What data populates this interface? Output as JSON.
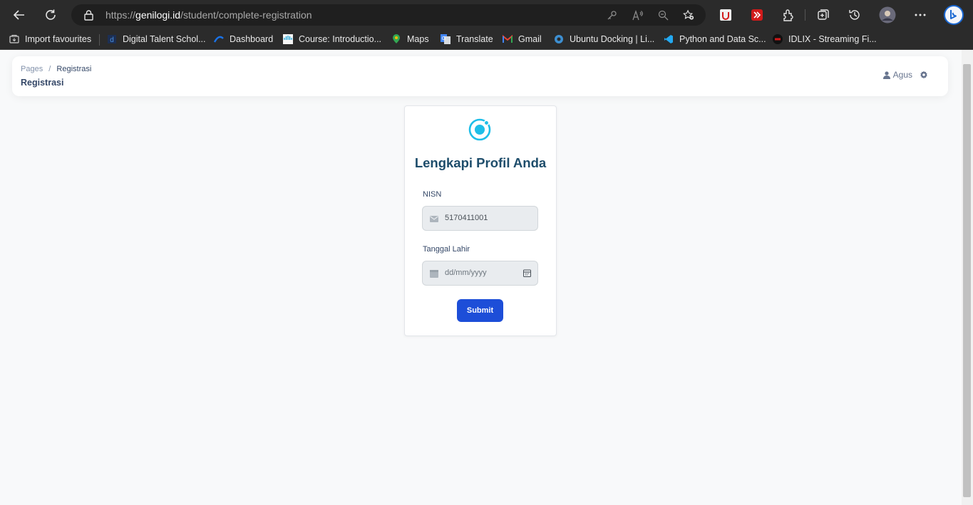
{
  "browser": {
    "url_prefix": "https://",
    "url_domain": "genilogi.id",
    "url_path": "/student/complete-registration",
    "bookmarks": [
      {
        "label": "Import favourites",
        "icon": "import-icon",
        "color": "#cfcfcf"
      },
      {
        "label": "Digital Talent Schol...",
        "icon": "dts-icon",
        "color": "#2f6fd6"
      },
      {
        "label": "Dashboard",
        "icon": "dashboard-icon",
        "color": "#1a73e8"
      },
      {
        "label": "Course: Introductio...",
        "icon": "cisco-icon",
        "color": "#049fd9"
      },
      {
        "label": "Maps",
        "icon": "maps-icon",
        "color": "#34a853"
      },
      {
        "label": "Translate",
        "icon": "translate-icon",
        "color": "#4285f4"
      },
      {
        "label": "Gmail",
        "icon": "gmail-icon",
        "color": "#ea4335"
      },
      {
        "label": "Ubuntu Docking | Li...",
        "icon": "ubuntu-icon",
        "color": "#3d8fd1"
      },
      {
        "label": "Python and Data Sc...",
        "icon": "vscode-icon",
        "color": "#23a9f2"
      },
      {
        "label": "IDLIX - Streaming Fi...",
        "icon": "idlix-icon",
        "color": "#d11a1a"
      }
    ]
  },
  "header": {
    "breadcrumb_root": "Pages",
    "breadcrumb_sep": "/",
    "breadcrumb_current": "Registrasi",
    "title": "Registrasi",
    "user": "Agus"
  },
  "form": {
    "title": "Lengkapi Profil Anda",
    "nisn_label": "NISN",
    "nisn_value": "5170411001",
    "dob_label": "Tanggal Lahir",
    "dob_placeholder": "dd/mm/yyyy",
    "submit_label": "Submit"
  },
  "colors": {
    "accent": "#1d4ed8",
    "title": "#1e4d6b",
    "logo": "#1ebee8"
  }
}
